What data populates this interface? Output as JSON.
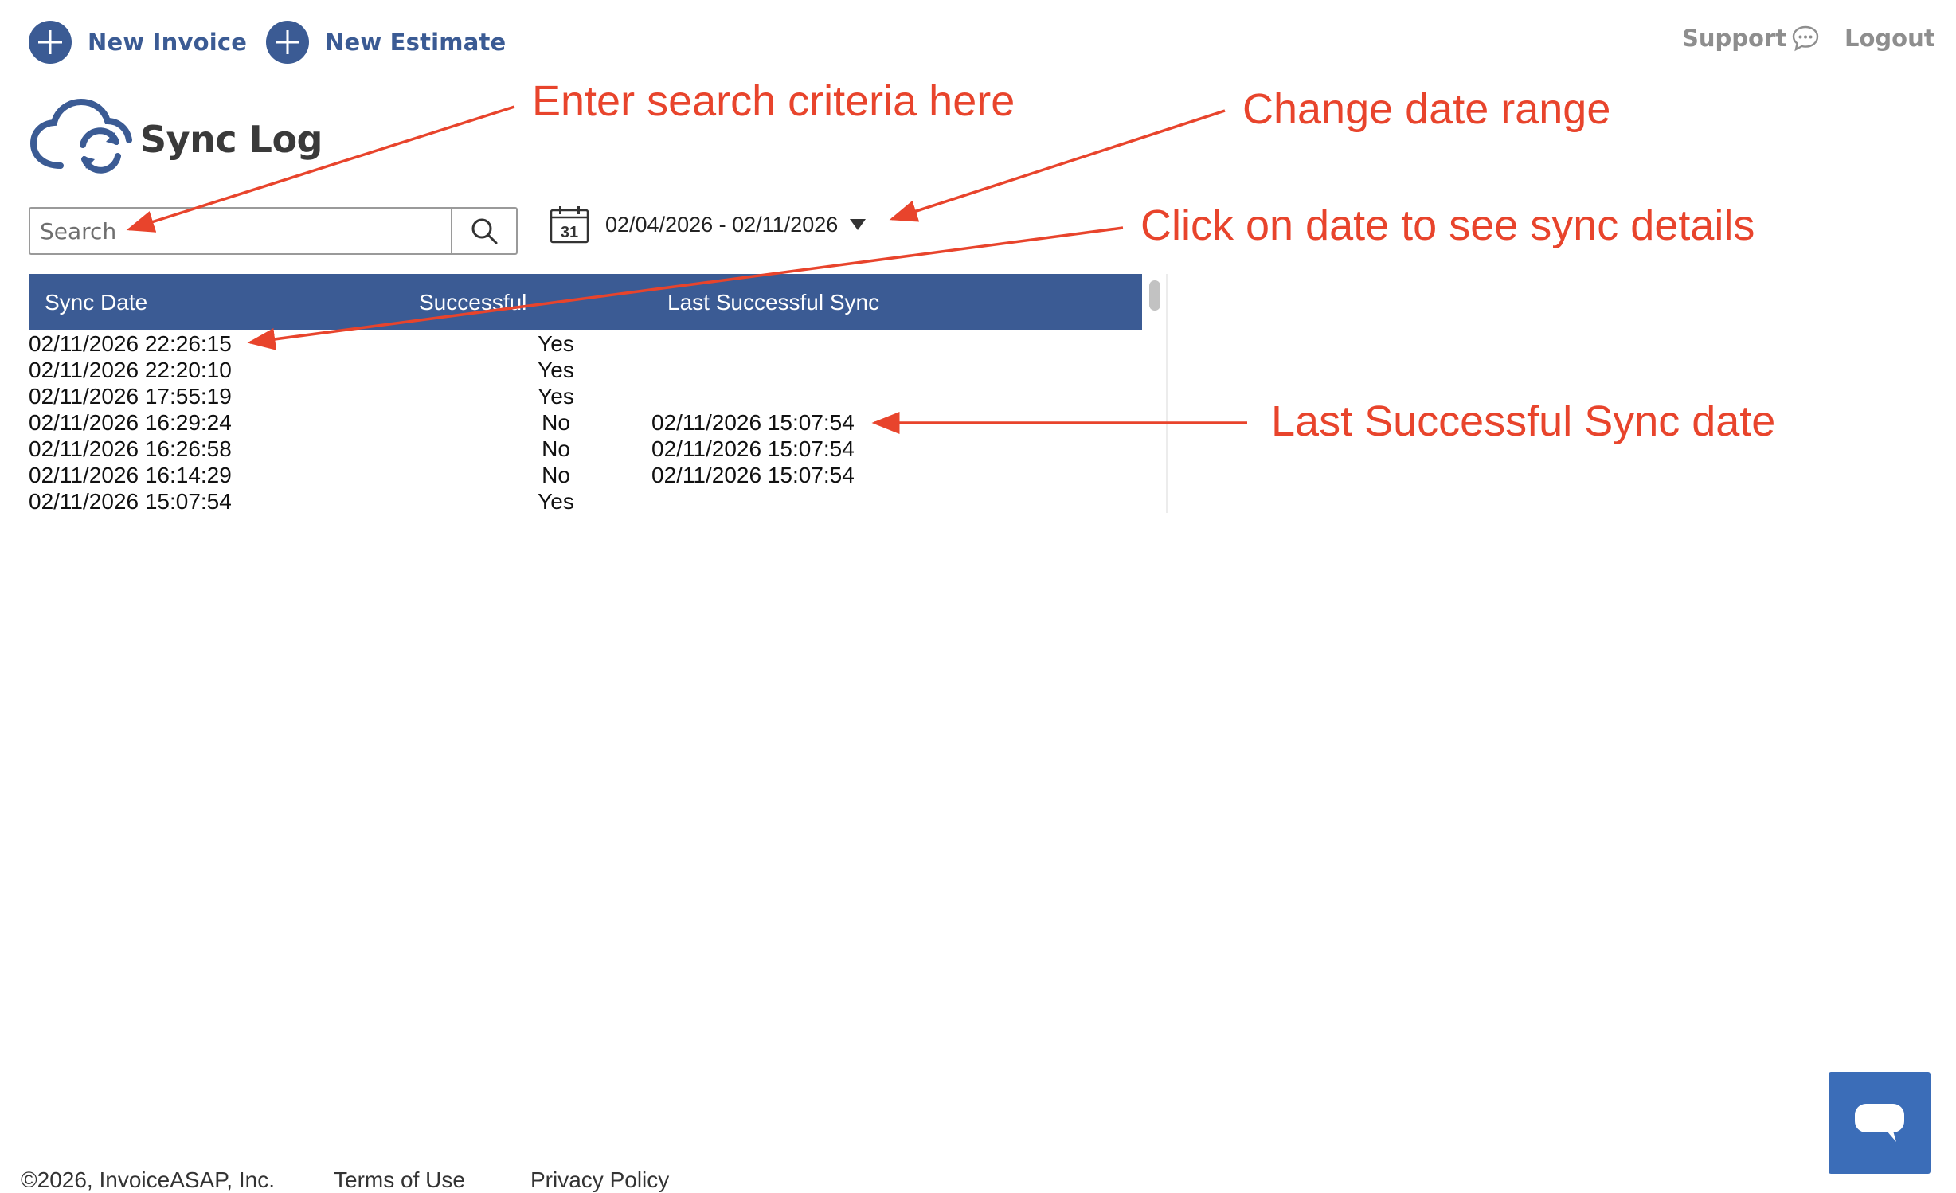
{
  "header": {
    "new_invoice_label": "New Invoice",
    "new_estimate_label": "New Estimate",
    "support_label": "Support",
    "logout_label": "Logout"
  },
  "page": {
    "title": "Sync Log"
  },
  "search": {
    "placeholder": "Search",
    "value": ""
  },
  "date_range": {
    "text": "02/04/2026 - 02/11/2026",
    "calendar_day": "31"
  },
  "table": {
    "headers": [
      "Sync Date",
      "Successful",
      "Last Successful Sync"
    ],
    "rows": [
      {
        "sync_date": "02/11/2026 22:26:15",
        "successful": "Yes",
        "last_successful_sync": ""
      },
      {
        "sync_date": "02/11/2026 22:20:10",
        "successful": "Yes",
        "last_successful_sync": ""
      },
      {
        "sync_date": "02/11/2026 17:55:19",
        "successful": "Yes",
        "last_successful_sync": ""
      },
      {
        "sync_date": "02/11/2026 16:29:24",
        "successful": "No",
        "last_successful_sync": "02/11/2026 15:07:54"
      },
      {
        "sync_date": "02/11/2026 16:26:58",
        "successful": "No",
        "last_successful_sync": "02/11/2026 15:07:54"
      },
      {
        "sync_date": "02/11/2026 16:14:29",
        "successful": "No",
        "last_successful_sync": "02/11/2026 15:07:54"
      },
      {
        "sync_date": "02/11/2026 15:07:54",
        "successful": "Yes",
        "last_successful_sync": ""
      }
    ]
  },
  "annotations": {
    "search": "Enter search criteria here",
    "date_range": "Change date range",
    "click_date": "Click on date to see sync details",
    "last_sync": "Last Successful Sync date"
  },
  "footer": {
    "copyright": "©2026, InvoiceASAP, Inc.",
    "terms": "Terms of Use",
    "privacy": "Privacy Policy"
  },
  "colors": {
    "brand_blue": "#3b5b94",
    "annotation_red": "#e8442c",
    "chat_blue": "#3b6db8"
  },
  "icons": [
    "plus-circle-icon",
    "chat-bubble-icon",
    "cloud-sync-icon",
    "search-icon",
    "calendar-icon",
    "caret-down-icon",
    "chat-icon"
  ]
}
